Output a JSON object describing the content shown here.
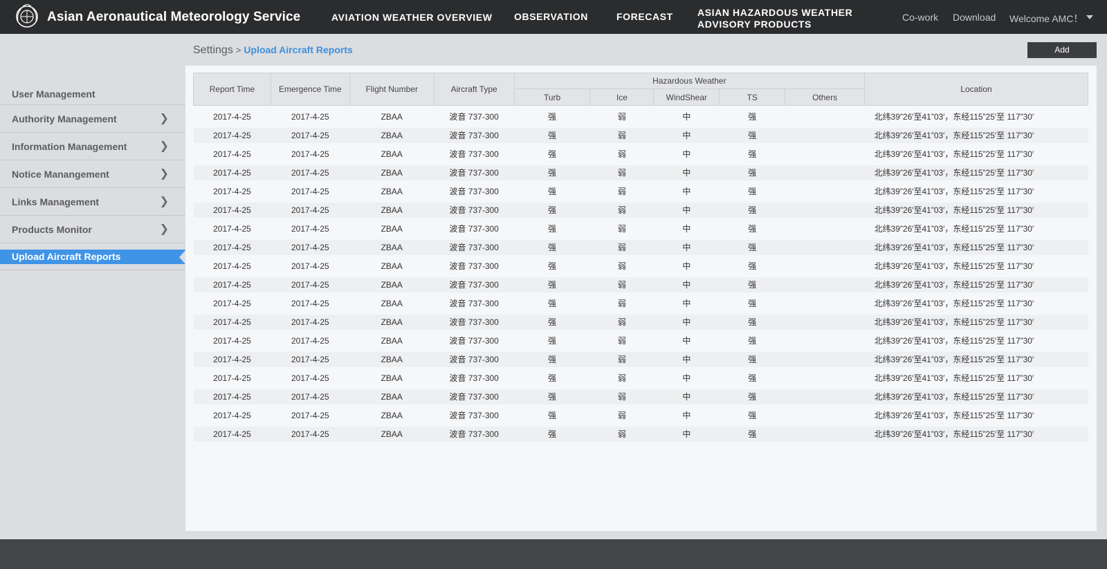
{
  "header": {
    "brand": "Asian Aeronautical Meteorology Service",
    "nav": {
      "overview": "AVIATION WEATHER OVERVIEW",
      "observation": "OBSERVATION",
      "forecast": "FORECAST",
      "hazard_line1": "ASIAN HAZARDOUS WEATHER",
      "hazard_line2": "ADVISORY PRODUCTS"
    },
    "cowork": "Co-work",
    "download": "Download",
    "welcome": "Welcome AMC！"
  },
  "breadcrumb": {
    "root": "Settings",
    "separator": ">",
    "current": "Upload Aircraft Reports"
  },
  "add_label": "Add",
  "sidebar": {
    "heading": "User Management",
    "items": [
      {
        "label": "Authority Management"
      },
      {
        "label": "Information Management"
      },
      {
        "label": "Notice Manangement"
      },
      {
        "label": "Links Management"
      },
      {
        "label": "Products Monitor"
      }
    ],
    "active": "Upload Aircraft Reports"
  },
  "table": {
    "headers": {
      "report_time": "Report Time",
      "emergence_time": "Emergence Time",
      "flight_number": "Flight Number",
      "aircraft_type": "Aircraft Type",
      "hazardous_weather": "Hazardous Weather",
      "turb": "Turb",
      "ice": "Ice",
      "windshear": "WindShear",
      "ts": "TS",
      "others": "Others",
      "location": "Location"
    },
    "rows": [
      [
        "2017-4-25",
        "2017-4-25",
        "ZBAA",
        "波音 737-300",
        "强",
        "弱",
        "中",
        "强",
        "",
        "北纬39”26′至41”03′，东经115”25′至 117”30′"
      ],
      [
        "2017-4-25",
        "2017-4-25",
        "ZBAA",
        "波音 737-300",
        "强",
        "弱",
        "中",
        "强",
        "",
        "北纬39”26′至41”03′，东经115”25′至 117”30′"
      ],
      [
        "2017-4-25",
        "2017-4-25",
        "ZBAA",
        "波音 737-300",
        "强",
        "弱",
        "中",
        "强",
        "",
        "北纬39”26′至41”03′，东经115”25′至 117”30′"
      ],
      [
        "2017-4-25",
        "2017-4-25",
        "ZBAA",
        "波音 737-300",
        "强",
        "弱",
        "中",
        "强",
        "",
        "北纬39”26′至41”03′，东经115”25′至 117”30′"
      ],
      [
        "2017-4-25",
        "2017-4-25",
        "ZBAA",
        "波音 737-300",
        "强",
        "弱",
        "中",
        "强",
        "",
        "北纬39”26′至41”03′，东经115”25′至 117”30′"
      ],
      [
        "2017-4-25",
        "2017-4-25",
        "ZBAA",
        "波音 737-300",
        "强",
        "弱",
        "中",
        "强",
        "",
        "北纬39”26′至41”03′，东经115”25′至 117”30′"
      ],
      [
        "2017-4-25",
        "2017-4-25",
        "ZBAA",
        "波音 737-300",
        "强",
        "弱",
        "中",
        "强",
        "",
        "北纬39”26′至41”03′，东经115”25′至 117”30′"
      ],
      [
        "2017-4-25",
        "2017-4-25",
        "ZBAA",
        "波音 737-300",
        "强",
        "弱",
        "中",
        "强",
        "",
        "北纬39”26′至41”03′，东经115”25′至 117”30′"
      ],
      [
        "2017-4-25",
        "2017-4-25",
        "ZBAA",
        "波音 737-300",
        "强",
        "弱",
        "中",
        "强",
        "",
        "北纬39”26′至41”03′，东经115”25′至 117”30′"
      ],
      [
        "2017-4-25",
        "2017-4-25",
        "ZBAA",
        "波音 737-300",
        "强",
        "弱",
        "中",
        "强",
        "",
        "北纬39”26′至41”03′，东经115”25′至 117”30′"
      ],
      [
        "2017-4-25",
        "2017-4-25",
        "ZBAA",
        "波音 737-300",
        "强",
        "弱",
        "中",
        "强",
        "",
        "北纬39”26′至41”03′，东经115”25′至 117”30′"
      ],
      [
        "2017-4-25",
        "2017-4-25",
        "ZBAA",
        "波音 737-300",
        "强",
        "弱",
        "中",
        "强",
        "",
        "北纬39”26′至41”03′，东经115”25′至 117”30′"
      ],
      [
        "2017-4-25",
        "2017-4-25",
        "ZBAA",
        "波音 737-300",
        "强",
        "弱",
        "中",
        "强",
        "",
        "北纬39”26′至41”03′，东经115”25′至 117”30′"
      ],
      [
        "2017-4-25",
        "2017-4-25",
        "ZBAA",
        "波音 737-300",
        "强",
        "弱",
        "中",
        "强",
        "",
        "北纬39”26′至41”03′，东经115”25′至 117”30′"
      ],
      [
        "2017-4-25",
        "2017-4-25",
        "ZBAA",
        "波音 737-300",
        "强",
        "弱",
        "中",
        "强",
        "",
        "北纬39”26′至41”03′，东经115”25′至 117”30′"
      ],
      [
        "2017-4-25",
        "2017-4-25",
        "ZBAA",
        "波音 737-300",
        "强",
        "弱",
        "中",
        "强",
        "",
        "北纬39”26′至41”03′，东经115”25′至 117”30′"
      ],
      [
        "2017-4-25",
        "2017-4-25",
        "ZBAA",
        "波音 737-300",
        "强",
        "弱",
        "中",
        "强",
        "",
        "北纬39”26′至41”03′，东经115”25′至 117”30′"
      ],
      [
        "2017-4-25",
        "2017-4-25",
        "ZBAA",
        "波音 737-300",
        "强",
        "弱",
        "中",
        "强",
        "",
        "北纬39”26′至41”03′，东经115”25′至 117”30′"
      ]
    ]
  },
  "icons": {
    "logo": "wmo-emblem-icon",
    "chevron": "chevron-right-icon",
    "caret": "caret-down-icon"
  },
  "colors": {
    "topbar": "#2b2c2e",
    "accent": "#4094e6",
    "footer": "#444548"
  }
}
